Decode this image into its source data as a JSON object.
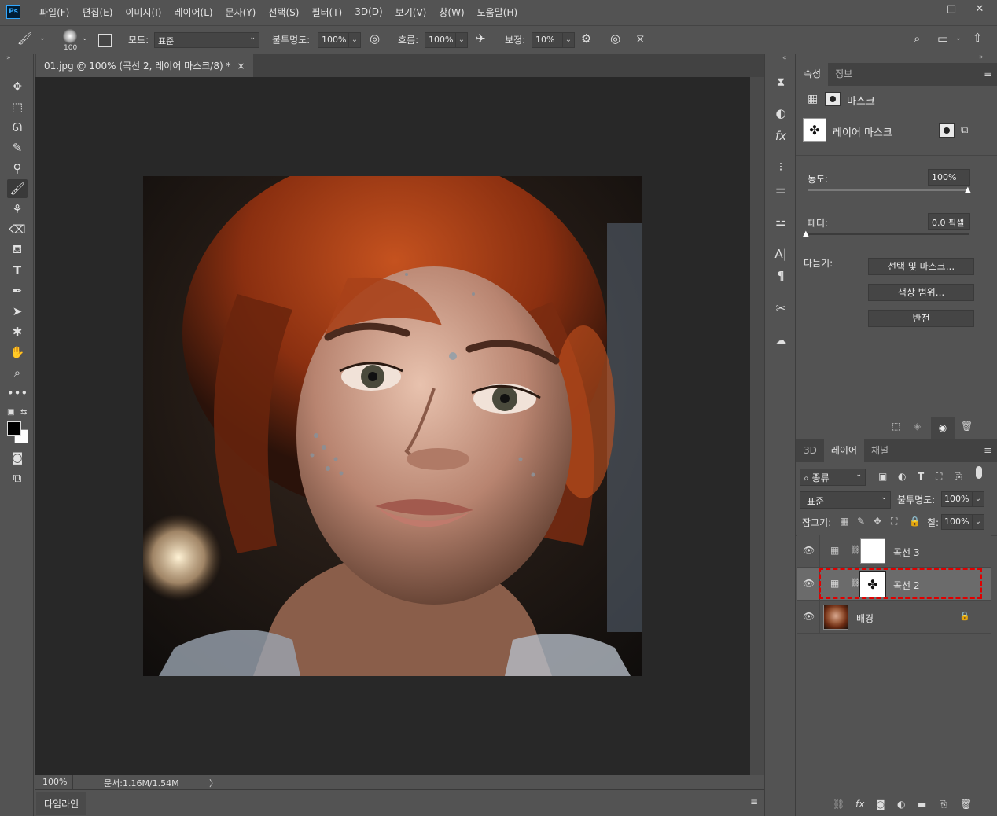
{
  "app": {
    "logo": "Ps",
    "menu": [
      "파일(F)",
      "편집(E)",
      "이미지(I)",
      "레이어(L)",
      "문자(Y)",
      "선택(S)",
      "필터(T)",
      "3D(D)",
      "보기(V)",
      "창(W)",
      "도움말(H)"
    ],
    "window_controls": [
      "–",
      "□",
      "✕"
    ]
  },
  "options": {
    "brush_size": "100",
    "mode_label": "모드:",
    "mode_value": "표준",
    "opacity_label": "불투명도:",
    "opacity_value": "100%",
    "flow_label": "흐름:",
    "flow_value": "100%",
    "smoothing_label": "보정:",
    "smoothing_value": "10%"
  },
  "document": {
    "tab_title": "01.jpg @ 100% (곡선 2, 레이어 마스크/8) *",
    "tab_close": "×",
    "zoom": "100%",
    "doc_info": "문서:1.16M/1.54M",
    "status_arrow": "〉",
    "timeline_label": "타임라인"
  },
  "properties": {
    "tabs": [
      "속성",
      "정보"
    ],
    "section_title": "마스크",
    "mask_name": "레이어 마스크",
    "density_label": "농도:",
    "density_value": "100%",
    "density_level": 1.0,
    "feather_label": "페더:",
    "feather_value": "0.0 픽셀",
    "feather_level": 0.0,
    "refine_label": "다듬기:",
    "btn_select_mask": "선택 및 마스크...",
    "btn_color_range": "색상 범위...",
    "btn_invert": "반전"
  },
  "layers": {
    "tabs": [
      "3D",
      "레이어",
      "채널"
    ],
    "filter_label": "종류",
    "blend_mode": "표준",
    "opacity_label": "불투명도:",
    "opacity_value": "100%",
    "lock_label": "잠그기:",
    "fill_label": "칠:",
    "fill_value": "100%",
    "items": [
      {
        "name": "곡선 3",
        "selected": false
      },
      {
        "name": "곡선 2",
        "selected": true
      },
      {
        "name": "배경",
        "selected": false
      }
    ]
  },
  "colors": {
    "foreground": "#000000",
    "background": "#ffffff",
    "highlight": "#e00000"
  }
}
